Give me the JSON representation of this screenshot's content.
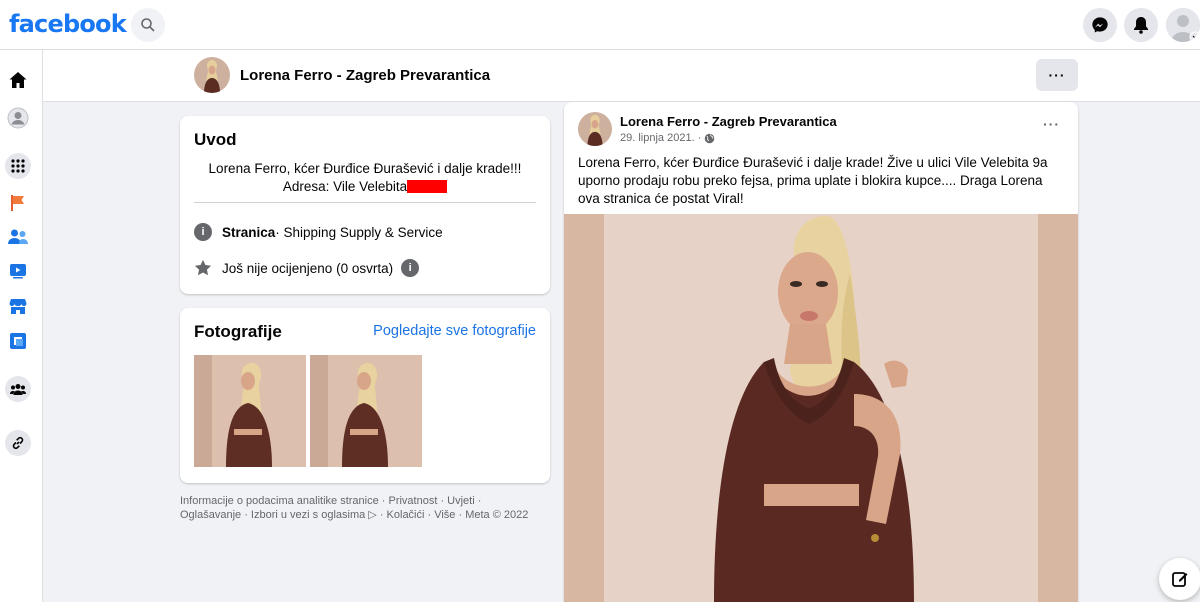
{
  "topbar": {
    "logo": "facebook",
    "search_icon": "search-icon",
    "messenger_icon": "messenger-icon",
    "notifications_icon": "bell-icon",
    "account_icon": "account-avatar"
  },
  "left_rail": {
    "icons": [
      "home-icon",
      "profile-icon",
      "menu-grid-icon",
      "pages-flag-icon",
      "friends-icon",
      "watch-icon",
      "marketplace-icon",
      "gaming-icon",
      "groups-icon",
      "link-icon"
    ]
  },
  "page_header": {
    "title": "Lorena Ferro - Zagreb Prevarantica",
    "more_label": "···"
  },
  "intro": {
    "title": "Uvod",
    "bio_line1": "Lorena Ferro, kćer Đurđice Đurašević i dalje krade!!!",
    "bio_line2": "Adresa: Vile Velebita",
    "category_label": "Stranica",
    "category_value": " · Shipping Supply & Service",
    "rating_text": "Još nije ocijenjeno (0 osvrta)"
  },
  "photos": {
    "title": "Fotografije",
    "see_all": "Pogledajte sve fotografije",
    "count": 2
  },
  "footer": {
    "text": "Informacije o podacima analitike stranice · Privatnost · Uvjeti · Oglašavanje · Izbori u vezi s oglasima ▷ · Kolačići · Više · Meta © 2022"
  },
  "post": {
    "author": "Lorena Ferro - Zagreb Prevarantica",
    "date": "29. lipnja 2021.",
    "privacy_icon": "globe-icon",
    "more_label": "···",
    "text": "Lorena Ferro, kćer Đurđice Đurašević i dalje krade! Žive u ulici Vile Velebita 9a uporno prodaju robu preko fejsa, prima uplate i blokira kupce.... Draga Lorena ova stranica će postat Viral!"
  },
  "colors": {
    "brand": "#1877f2",
    "link": "#1b74e4",
    "redaction": "#ff0000",
    "background": "#f0f2f5"
  }
}
